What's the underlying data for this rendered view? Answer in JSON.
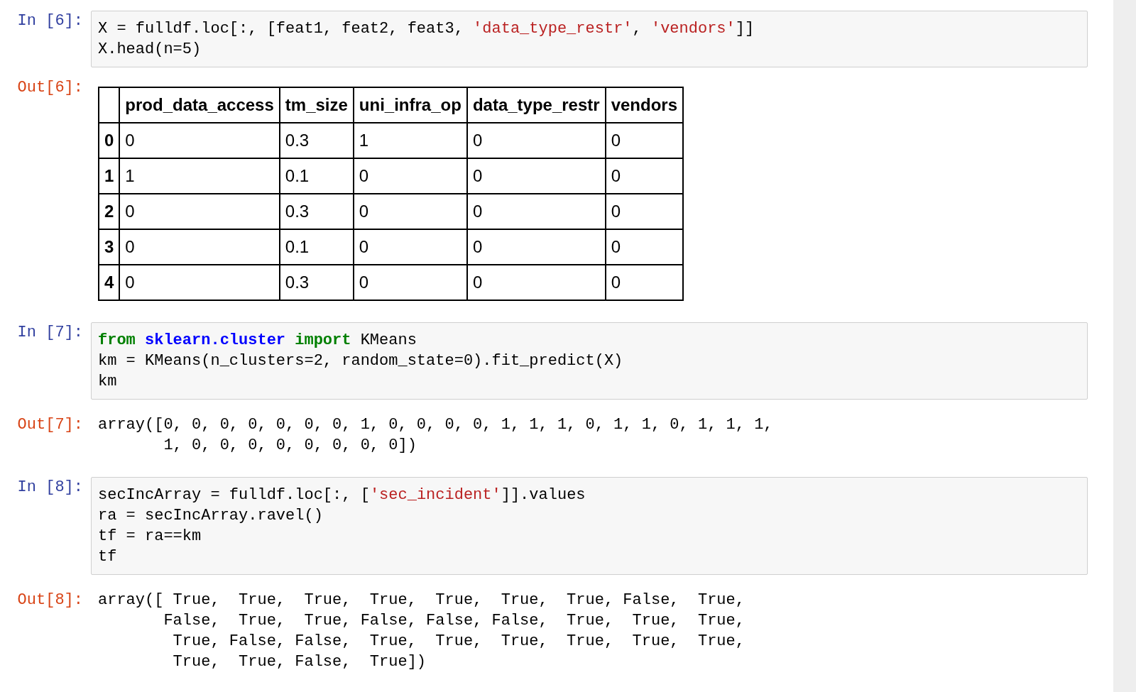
{
  "cells": [
    {
      "kind": "input",
      "prompt": "In [6]:",
      "lines": [
        [
          {
            "t": "X = fulldf.loc[:, [feat1, feat2, feat3, ",
            "kind": "plain"
          },
          {
            "t": "'data_type_restr'",
            "kind": "string"
          },
          {
            "t": ", ",
            "kind": "plain"
          },
          {
            "t": "'vendors'",
            "kind": "string"
          },
          {
            "t": "]]",
            "kind": "plain"
          }
        ],
        [
          {
            "t": "X.head(n=5)",
            "kind": "plain"
          }
        ]
      ]
    },
    {
      "kind": "table",
      "prompt": "Out[6]:",
      "columns": [
        "prod_data_access",
        "tm_size",
        "uni_infra_op",
        "data_type_restr",
        "vendors"
      ],
      "rows": [
        {
          "index": "0",
          "cells": [
            "0",
            "0.3",
            "1",
            "0",
            "0"
          ]
        },
        {
          "index": "1",
          "cells": [
            "1",
            "0.1",
            "0",
            "0",
            "0"
          ]
        },
        {
          "index": "2",
          "cells": [
            "0",
            "0.3",
            "0",
            "0",
            "0"
          ]
        },
        {
          "index": "3",
          "cells": [
            "0",
            "0.1",
            "0",
            "0",
            "0"
          ]
        },
        {
          "index": "4",
          "cells": [
            "0",
            "0.3",
            "0",
            "0",
            "0"
          ]
        }
      ]
    },
    {
      "kind": "input",
      "prompt": "In [7]:",
      "lines": [
        [
          {
            "t": "from ",
            "kind": "keyword"
          },
          {
            "t": "sklearn.cluster ",
            "kind": "module"
          },
          {
            "t": "import",
            "kind": "keyword"
          },
          {
            "t": " KMeans",
            "kind": "plain"
          }
        ],
        [
          {
            "t": "km = KMeans(n_clusters=2, random_state=0).fit_predict(X)",
            "kind": "plain"
          }
        ],
        [
          {
            "t": "km",
            "kind": "plain"
          }
        ]
      ]
    },
    {
      "kind": "text",
      "prompt": "Out[7]:",
      "text": "array([0, 0, 0, 0, 0, 0, 0, 1, 0, 0, 0, 0, 1, 1, 1, 0, 1, 1, 0, 1, 1, 1,\n       1, 0, 0, 0, 0, 0, 0, 0, 0])"
    },
    {
      "kind": "input",
      "prompt": "In [8]:",
      "lines": [
        [
          {
            "t": "secIncArray = fulldf.loc[:, [",
            "kind": "plain"
          },
          {
            "t": "'sec_incident'",
            "kind": "string"
          },
          {
            "t": "]].values",
            "kind": "plain"
          }
        ],
        [
          {
            "t": "ra = secIncArray.ravel()",
            "kind": "plain"
          }
        ],
        [
          {
            "t": "tf = ra==km",
            "kind": "plain"
          }
        ],
        [
          {
            "t": "tf",
            "kind": "plain"
          }
        ]
      ]
    },
    {
      "kind": "text",
      "prompt": "Out[8]:",
      "text": "array([ True,  True,  True,  True,  True,  True,  True, False,  True,\n       False,  True,  True, False, False, False,  True,  True,  True,\n        True, False, False,  True,  True,  True,  True,  True,  True,\n        True,  True, False,  True])"
    }
  ]
}
